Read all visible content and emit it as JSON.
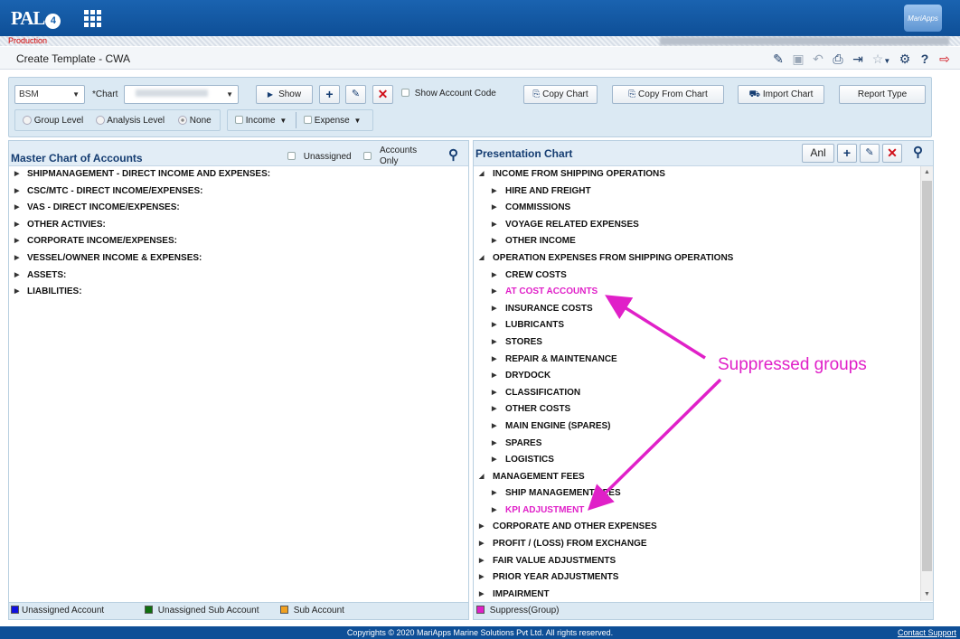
{
  "app": {
    "logo_text": "PAL",
    "logo_version": "4",
    "brand_text": "MariApps",
    "environment": "Production"
  },
  "header": {
    "title": "Create Template - CWA"
  },
  "toolbar_icons": [
    "edit-icon",
    "save-icon",
    "undo-icon",
    "print-icon",
    "export-icon",
    "favorite-icon",
    "settings-icon",
    "help-icon",
    "logout-icon"
  ],
  "filters": {
    "type_select": "BSM",
    "chart_label": "*Chart",
    "show_button": "Show",
    "show_account_code": "Show Account Code",
    "copy_chart": "Copy Chart",
    "copy_from_chart": "Copy From Chart",
    "import_chart": "Import Chart",
    "report_type": "Report Type",
    "group_level": "Group Level",
    "analysis_level": "Analysis Level",
    "none": "None",
    "income": "Income",
    "expense": "Expense"
  },
  "master": {
    "title": "Master Chart of Accounts",
    "unassigned": "Unassigned",
    "accounts_only_1": "Accounts",
    "accounts_only_2": "Only",
    "items": [
      "SHIPMANAGEMENT - DIRECT INCOME AND EXPENSES:",
      "CSC/MTC - DIRECT INCOME/EXPENSES:",
      "VAS - DIRECT INCOME/EXPENSES:",
      "OTHER ACTIVIES:",
      "CORPORATE INCOME/EXPENSES:",
      "VESSEL/OWNER INCOME & EXPENSES:",
      "ASSETS:",
      "LIABILITIES:"
    ],
    "legend": {
      "unassigned_account": "Unassigned Account",
      "unassigned_sub": "Unassigned Sub Account",
      "sub_account": "Sub Account"
    }
  },
  "presentation": {
    "title": "Presentation Chart",
    "anl_button": "Anl",
    "items": [
      {
        "label": "INCOME FROM SHIPPING OPERATIONS",
        "level": 0,
        "expanded": true
      },
      {
        "label": "HIRE AND FREIGHT",
        "level": 1
      },
      {
        "label": "COMMISSIONS",
        "level": 1
      },
      {
        "label": "VOYAGE RELATED EXPENSES",
        "level": 1
      },
      {
        "label": "OTHER INCOME",
        "level": 1
      },
      {
        "label": "OPERATION EXPENSES FROM SHIPPING OPERATIONS",
        "level": 0,
        "expanded": true
      },
      {
        "label": "CREW COSTS",
        "level": 1
      },
      {
        "label": "AT COST ACCOUNTS",
        "level": 1,
        "suppressed": true
      },
      {
        "label": "INSURANCE COSTS",
        "level": 1
      },
      {
        "label": "LUBRICANTS",
        "level": 1
      },
      {
        "label": "STORES",
        "level": 1
      },
      {
        "label": "REPAIR & MAINTENANCE",
        "level": 1
      },
      {
        "label": "DRYDOCK",
        "level": 1
      },
      {
        "label": "CLASSIFICATION",
        "level": 1
      },
      {
        "label": "OTHER COSTS",
        "level": 1
      },
      {
        "label": "MAIN ENGINE (SPARES)",
        "level": 1
      },
      {
        "label": "SPARES",
        "level": 1
      },
      {
        "label": "LOGISTICS",
        "level": 1
      },
      {
        "label": "MANAGEMENT FEES",
        "level": 0,
        "expanded": true
      },
      {
        "label": "SHIP MANAGEMENT FEES",
        "level": 1
      },
      {
        "label": "KPI ADJUSTMENT",
        "level": 1,
        "suppressed": true
      },
      {
        "label": "CORPORATE AND OTHER EXPENSES",
        "level": 0
      },
      {
        "label": "PROFIT / (LOSS) FROM EXCHANGE",
        "level": 0
      },
      {
        "label": "FAIR VALUE ADJUSTMENTS",
        "level": 0
      },
      {
        "label": "PRIOR YEAR ADJUSTMENTS",
        "level": 0
      },
      {
        "label": "IMPAIRMENT",
        "level": 0
      }
    ],
    "legend": {
      "suppress": "Suppress(Group)"
    }
  },
  "annotation": {
    "text": "Suppressed groups",
    "color": "#e020c8"
  },
  "colors": {
    "unassigned_account": "#1010e0",
    "unassigned_sub": "#107010",
    "sub_account": "#f0a020",
    "suppress": "#e020c8"
  },
  "footer": {
    "copyright": "Copyrights © 2020 MariApps Marine Solutions Pvt Ltd. All rights reserved.",
    "contact": "Contact Support"
  }
}
